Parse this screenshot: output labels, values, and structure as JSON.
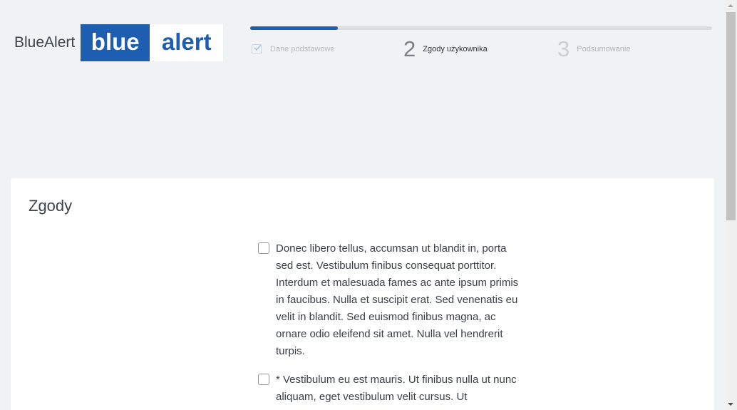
{
  "brand": {
    "name": "BlueAlert",
    "logo_part1": "blue",
    "logo_part2": "alert"
  },
  "steps": {
    "progress_fraction": 0.19,
    "items": [
      {
        "label": "Dane podstawowe",
        "state": "completed",
        "icon": "checkbox-check-icon"
      },
      {
        "number": "2",
        "label": "Zgody użykownika",
        "state": "active"
      },
      {
        "number": "3",
        "label": "Podsumowanie",
        "state": "pending"
      }
    ]
  },
  "card": {
    "title": "Zgody",
    "consents": [
      {
        "checked": false,
        "text": "Donec libero tellus, accumsan ut blandit in, porta sed est. Vestibulum finibus consequat porttitor. Interdum et malesuada fames ac ante ipsum primis in faucibus. Nulla et suscipit erat. Sed venenatis eu velit in blandit. Sed euismod finibus magna, ac ornare odio eleifend sit amet. Nulla vel hendrerit turpis."
      },
      {
        "checked": false,
        "text": "* Vestibulum eu est mauris. Ut finibus nulla ut nunc aliquam, eget vestibulum velit cursus. Ut"
      }
    ]
  },
  "colors": {
    "brand_blue": "#1e5eb0",
    "background": "#f1f2f5",
    "card": "#ffffff"
  }
}
